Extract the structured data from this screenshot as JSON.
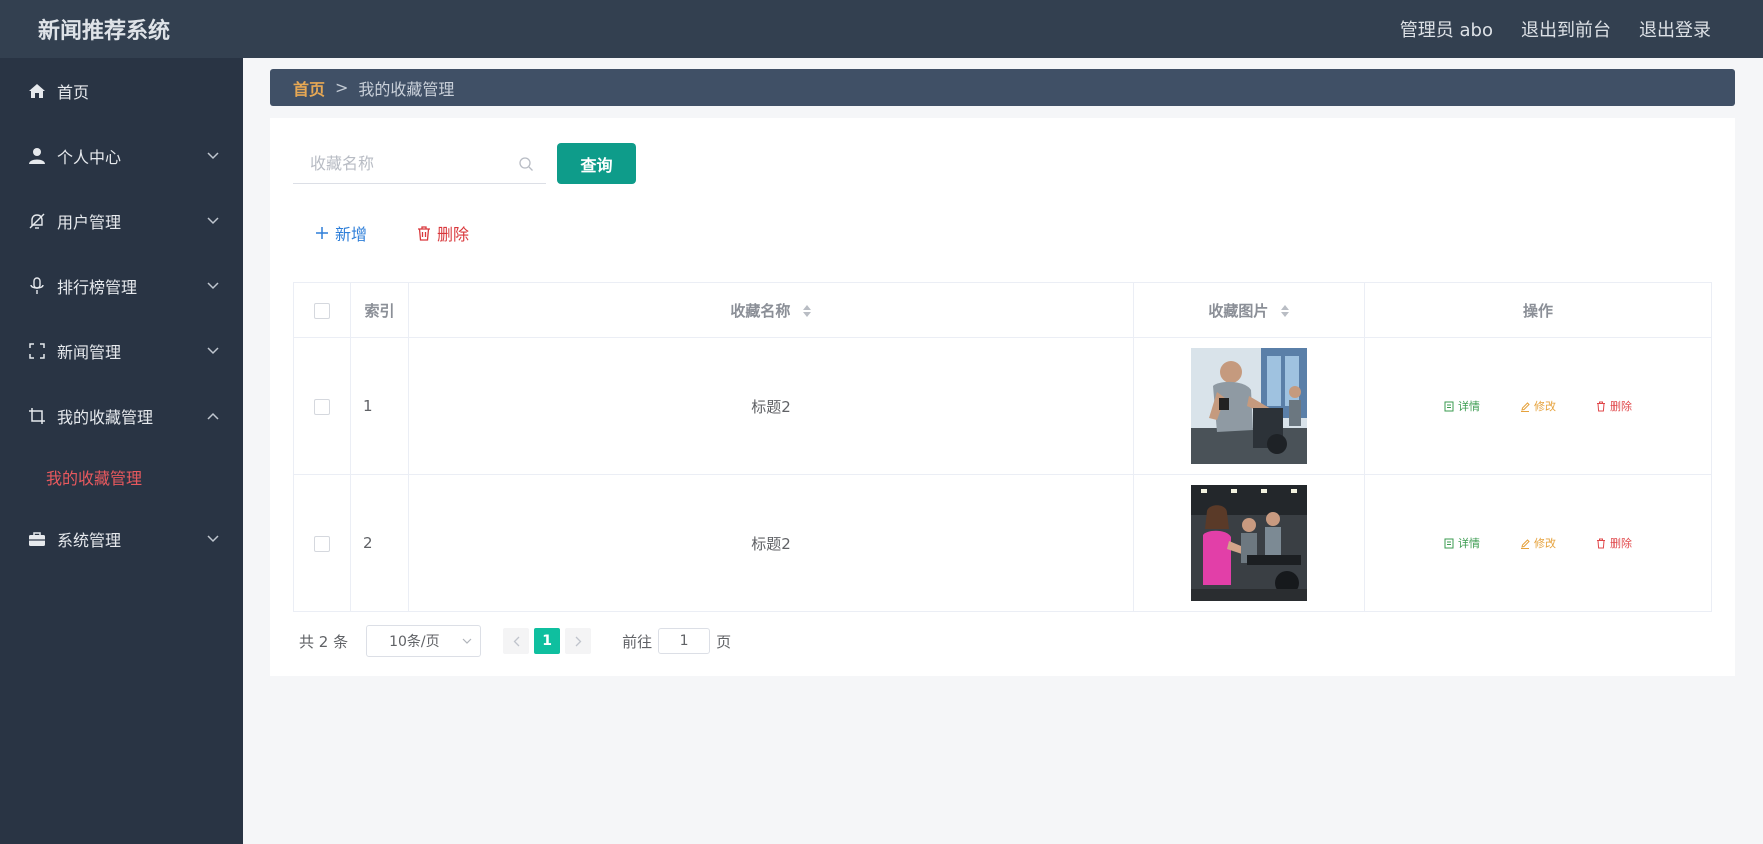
{
  "header": {
    "title": "新闻推荐系统",
    "user": "管理员 abo",
    "to_front": "退出到前台",
    "logout": "退出登录"
  },
  "sidebar": {
    "items": [
      {
        "label": "首页",
        "icon": "home-icon"
      },
      {
        "label": "个人中心",
        "icon": "user-icon"
      },
      {
        "label": "用户管理",
        "icon": "bell-slash-icon"
      },
      {
        "label": "排行榜管理",
        "icon": "microphone-icon"
      },
      {
        "label": "新闻管理",
        "icon": "fullscreen-icon"
      },
      {
        "label": "我的收藏管理",
        "icon": "crop-icon"
      },
      {
        "label": "系统管理",
        "icon": "briefcase-icon"
      }
    ],
    "active_sub": "我的收藏管理"
  },
  "breadcrumb": {
    "home": "首页",
    "separator": ">",
    "current": "我的收藏管理"
  },
  "search": {
    "placeholder": "收藏名称",
    "button": "查询"
  },
  "actions": {
    "add": "新增",
    "delete": "删除"
  },
  "table": {
    "headers": {
      "index": "索引",
      "name": "收藏名称",
      "image": "收藏图片",
      "ops": "操作"
    },
    "rows": [
      {
        "index": "1",
        "name": "标题2",
        "image": "cycling-gym-men"
      },
      {
        "index": "2",
        "name": "标题2",
        "image": "cycling-gym-women"
      }
    ],
    "ops": {
      "detail": "详情",
      "edit": "修改",
      "remove": "删除"
    }
  },
  "pagination": {
    "total": "共 2 条",
    "page_size": "10条/页",
    "current_page": "1",
    "goto_label": "前往",
    "goto_value": "1",
    "page_suffix": "页"
  },
  "colors": {
    "header_bg": "#334050",
    "sidebar_bg": "#293444",
    "breadcrumb_bg": "#405066",
    "accent": "#0e9c8a",
    "active_menu": "#e8595e"
  }
}
